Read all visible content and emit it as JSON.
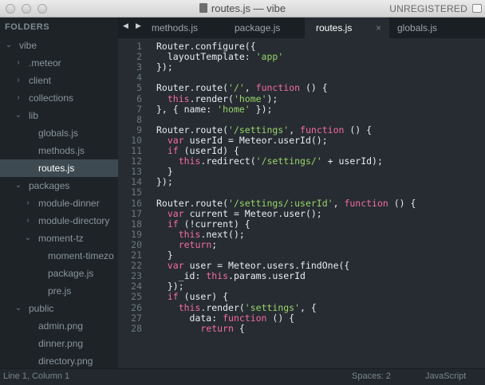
{
  "window": {
    "title": "routes.js — vibe",
    "license": "UNREGISTERED"
  },
  "sidebar": {
    "header": "FOLDERS",
    "items": [
      {
        "label": "vibe",
        "chevron": "⌄",
        "indent": 1
      },
      {
        "label": ".meteor",
        "chevron": "›",
        "indent": 2
      },
      {
        "label": "client",
        "chevron": "›",
        "indent": 2
      },
      {
        "label": "collections",
        "chevron": "›",
        "indent": 2
      },
      {
        "label": "lib",
        "chevron": "⌄",
        "indent": 2
      },
      {
        "label": "globals.js",
        "chevron": "",
        "indent": 3
      },
      {
        "label": "methods.js",
        "chevron": "",
        "indent": 3
      },
      {
        "label": "routes.js",
        "chevron": "",
        "indent": 3,
        "selected": true
      },
      {
        "label": "packages",
        "chevron": "⌄",
        "indent": 2
      },
      {
        "label": "module-dinner",
        "chevron": "›",
        "indent": 3
      },
      {
        "label": "module-directory",
        "chevron": "›",
        "indent": 3
      },
      {
        "label": "moment-tz",
        "chevron": "⌄",
        "indent": 3
      },
      {
        "label": "moment-timezo",
        "chevron": "",
        "indent": 4
      },
      {
        "label": "package.js",
        "chevron": "",
        "indent": 4
      },
      {
        "label": "pre.js",
        "chevron": "",
        "indent": 4
      },
      {
        "label": "public",
        "chevron": "⌄",
        "indent": 2
      },
      {
        "label": "admin.png",
        "chevron": "",
        "indent": 3
      },
      {
        "label": "dinner.png",
        "chevron": "",
        "indent": 3
      },
      {
        "label": "directory.png",
        "chevron": "",
        "indent": 3
      }
    ]
  },
  "tabs": {
    "nav_back": "◀",
    "nav_forward": "▶",
    "items": [
      {
        "label": "methods.js",
        "active": false
      },
      {
        "label": "package.js",
        "active": false
      },
      {
        "label": "routes.js",
        "active": true,
        "close": "×"
      },
      {
        "label": "globals.js",
        "active": false
      }
    ]
  },
  "editor": {
    "lines": [
      {
        "n": "1",
        "tokens": [
          [
            "Router.configure({",
            "p"
          ]
        ]
      },
      {
        "n": "2",
        "tokens": [
          [
            "  layoutTemplate: ",
            "p"
          ],
          [
            "'app'",
            "s"
          ]
        ]
      },
      {
        "n": "3",
        "tokens": [
          [
            "});",
            "p"
          ]
        ]
      },
      {
        "n": "4",
        "tokens": []
      },
      {
        "n": "5",
        "tokens": [
          [
            "Router.route(",
            "p"
          ],
          [
            "'/'",
            "s"
          ],
          [
            ", ",
            "p"
          ],
          [
            "function",
            "k"
          ],
          [
            " () {",
            "p"
          ]
        ]
      },
      {
        "n": "6",
        "tokens": [
          [
            "  ",
            "p"
          ],
          [
            "this",
            "k"
          ],
          [
            ".render(",
            "p"
          ],
          [
            "'home'",
            "s"
          ],
          [
            ");",
            "p"
          ]
        ]
      },
      {
        "n": "7",
        "tokens": [
          [
            "}, { name: ",
            "p"
          ],
          [
            "'home'",
            "s"
          ],
          [
            " });",
            "p"
          ]
        ]
      },
      {
        "n": "8",
        "tokens": []
      },
      {
        "n": "9",
        "tokens": [
          [
            "Router.route(",
            "p"
          ],
          [
            "'/settings'",
            "s"
          ],
          [
            ", ",
            "p"
          ],
          [
            "function",
            "k"
          ],
          [
            " () {",
            "p"
          ]
        ]
      },
      {
        "n": "10",
        "tokens": [
          [
            "  ",
            "p"
          ],
          [
            "var",
            "k"
          ],
          [
            " userId = Meteor.userId();",
            "p"
          ]
        ]
      },
      {
        "n": "11",
        "tokens": [
          [
            "  ",
            "p"
          ],
          [
            "if",
            "k"
          ],
          [
            " (userId) {",
            "p"
          ]
        ]
      },
      {
        "n": "12",
        "tokens": [
          [
            "    ",
            "p"
          ],
          [
            "this",
            "k"
          ],
          [
            ".redirect(",
            "p"
          ],
          [
            "'/settings/'",
            "s"
          ],
          [
            " + userId);",
            "p"
          ]
        ]
      },
      {
        "n": "13",
        "tokens": [
          [
            "  }",
            "p"
          ]
        ]
      },
      {
        "n": "14",
        "tokens": [
          [
            "});",
            "p"
          ]
        ]
      },
      {
        "n": "15",
        "tokens": []
      },
      {
        "n": "16",
        "tokens": [
          [
            "Router.route(",
            "p"
          ],
          [
            "'/settings/:userId'",
            "s"
          ],
          [
            ", ",
            "p"
          ],
          [
            "function",
            "k"
          ],
          [
            " () {",
            "p"
          ]
        ]
      },
      {
        "n": "17",
        "tokens": [
          [
            "  ",
            "p"
          ],
          [
            "var",
            "k"
          ],
          [
            " current = Meteor.user();",
            "p"
          ]
        ]
      },
      {
        "n": "18",
        "tokens": [
          [
            "  ",
            "p"
          ],
          [
            "if",
            "k"
          ],
          [
            " (!current) {",
            "p"
          ]
        ]
      },
      {
        "n": "19",
        "tokens": [
          [
            "    ",
            "p"
          ],
          [
            "this",
            "k"
          ],
          [
            ".next();",
            "p"
          ]
        ]
      },
      {
        "n": "20",
        "tokens": [
          [
            "    ",
            "p"
          ],
          [
            "return",
            "k"
          ],
          [
            ";",
            "p"
          ]
        ]
      },
      {
        "n": "21",
        "tokens": [
          [
            "  }",
            "p"
          ]
        ]
      },
      {
        "n": "22",
        "tokens": [
          [
            "  ",
            "p"
          ],
          [
            "var",
            "k"
          ],
          [
            " user = Meteor.users.findOne({",
            "p"
          ]
        ]
      },
      {
        "n": "23",
        "tokens": [
          [
            "    _id: ",
            "p"
          ],
          [
            "this",
            "k"
          ],
          [
            ".params.userId",
            "p"
          ]
        ]
      },
      {
        "n": "24",
        "tokens": [
          [
            "  });",
            "p"
          ]
        ]
      },
      {
        "n": "25",
        "tokens": [
          [
            "  ",
            "p"
          ],
          [
            "if",
            "k"
          ],
          [
            " (user) {",
            "p"
          ]
        ]
      },
      {
        "n": "26",
        "tokens": [
          [
            "    ",
            "p"
          ],
          [
            "this",
            "k"
          ],
          [
            ".render(",
            "p"
          ],
          [
            "'settings'",
            "s"
          ],
          [
            ", {",
            "p"
          ]
        ]
      },
      {
        "n": "27",
        "tokens": [
          [
            "      data: ",
            "p"
          ],
          [
            "function",
            "k"
          ],
          [
            " () {",
            "p"
          ]
        ]
      },
      {
        "n": "28",
        "tokens": [
          [
            "        ",
            "p"
          ],
          [
            "return",
            "k"
          ],
          [
            " {",
            "p"
          ]
        ]
      }
    ]
  },
  "status": {
    "position": "Line 1, Column 1",
    "spaces": "Spaces: 2",
    "syntax": "JavaScript"
  },
  "colors": {
    "string": "#9bd46c",
    "keyword": "#f56ca2",
    "plain": "#e6eef0",
    "editor_bg": "#262c31",
    "sidebar_bg": "#1e2327",
    "selected_bg": "#3d4a51"
  }
}
